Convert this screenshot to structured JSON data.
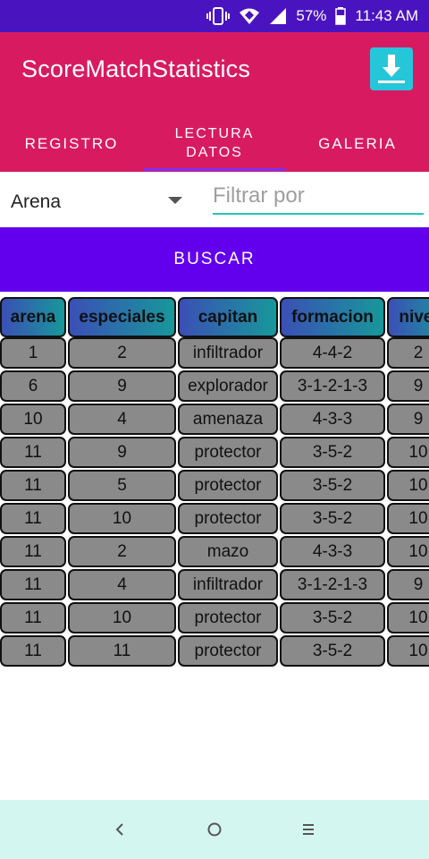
{
  "status_bar": {
    "battery": "57%",
    "time": "11:43 AM"
  },
  "app_bar": {
    "title": "ScoreMatchStatistics",
    "download_icon": "download-icon"
  },
  "tabs": [
    {
      "label": "REGISTRO",
      "active": false
    },
    {
      "label": "LECTURA DATOS",
      "active": true
    },
    {
      "label": "GALERIA",
      "active": false
    }
  ],
  "filter": {
    "spinner_value": "Arena",
    "input_placeholder": "Filtrar por",
    "input_value": ""
  },
  "buscar_label": "BUSCAR",
  "table": {
    "headers": [
      "arena",
      "especiales",
      "capitan",
      "formacion",
      "nivel"
    ],
    "rows": [
      [
        "1",
        "2",
        "infiltrador",
        "4-4-2",
        "2"
      ],
      [
        "6",
        "9",
        "explorador",
        "3-1-2-1-3",
        "9"
      ],
      [
        "10",
        "4",
        "amenaza",
        "4-3-3",
        "9"
      ],
      [
        "11",
        "9",
        "protector",
        "3-5-2",
        "10"
      ],
      [
        "11",
        "5",
        "protector",
        "3-5-2",
        "10"
      ],
      [
        "11",
        "10",
        "protector",
        "3-5-2",
        "10"
      ],
      [
        "11",
        "2",
        "mazo",
        "4-3-3",
        "10"
      ],
      [
        "11",
        "4",
        "infiltrador",
        "3-1-2-1-3",
        "9"
      ],
      [
        "11",
        "10",
        "protector",
        "3-5-2",
        "10"
      ],
      [
        "11",
        "11",
        "protector",
        "3-5-2",
        "10"
      ]
    ]
  },
  "colors": {
    "status_bar": "#4a13c0",
    "app_bar": "#d81b60",
    "buscar": "#6200ee",
    "accent": "#26c6da",
    "cell": "#8a8a8a",
    "nav_bar": "#d4f6f1"
  },
  "nav_icons": [
    "back-icon",
    "home-icon",
    "menu-icon"
  ]
}
